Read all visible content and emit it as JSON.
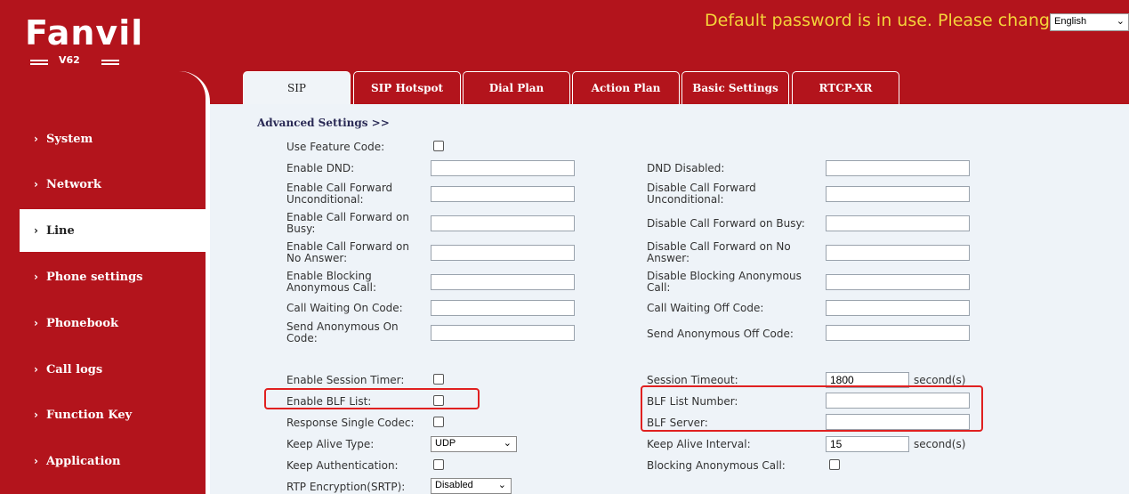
{
  "header": {
    "brand": "Fanvil",
    "model": "V62",
    "warning": "Default password is in use. Please change",
    "language": "English"
  },
  "sidebar": {
    "items": [
      {
        "label": "System"
      },
      {
        "label": "Network"
      },
      {
        "label": "Line"
      },
      {
        "label": "Phone settings"
      },
      {
        "label": "Phonebook"
      },
      {
        "label": "Call logs"
      },
      {
        "label": "Function Key"
      },
      {
        "label": "Application"
      }
    ],
    "active": "Line"
  },
  "tabs": [
    {
      "label": "SIP"
    },
    {
      "label": "SIP Hotspot"
    },
    {
      "label": "Dial Plan"
    },
    {
      "label": "Action Plan"
    },
    {
      "label": "Basic Settings"
    },
    {
      "label": "RTCP-XR"
    }
  ],
  "section_title": "Advanced Settings >>",
  "form": {
    "use_feature_code": "Use Feature Code:",
    "enable_dnd": "Enable DND:",
    "dnd_disabled": "DND Disabled:",
    "enable_cf_uncond_1": "Enable Call Forward",
    "enable_cf_uncond_2": "Unconditional:",
    "disable_cf_uncond_1": "Disable Call Forward",
    "disable_cf_uncond_2": "Unconditional:",
    "enable_cf_busy_1": "Enable Call Forward on",
    "enable_cf_busy_2": "Busy:",
    "disable_cf_busy": "Disable Call Forward on Busy:",
    "enable_cf_noans_1": "Enable Call Forward on",
    "enable_cf_noans_2": "No Answer:",
    "disable_cf_noans_1": "Disable Call Forward on No",
    "disable_cf_noans_2": "Answer:",
    "enable_block_anon_1": "Enable Blocking",
    "enable_block_anon_2": "Anonymous Call:",
    "disable_block_anon_1": "Disable Blocking Anonymous",
    "disable_block_anon_2": "Call:",
    "call_waiting_on": "Call Waiting On Code:",
    "call_waiting_off": "Call Waiting Off Code:",
    "send_anon_on_1": "Send Anonymous On",
    "send_anon_on_2": "Code:",
    "send_anon_off": "Send Anonymous Off Code:",
    "enable_session_timer": "Enable Session Timer:",
    "session_timeout": "Session Timeout:",
    "session_timeout_value": "1800",
    "session_timeout_unit": "second(s)",
    "enable_blf_list": "Enable BLF List:",
    "blf_list_number": "BLF List Number:",
    "response_single_codec": "Response Single Codec:",
    "blf_server": "BLF Server:",
    "keep_alive_type": "Keep Alive Type:",
    "keep_alive_type_value": "UDP",
    "keep_alive_interval": "Keep Alive Interval:",
    "keep_alive_interval_value": "15",
    "keep_alive_interval_unit": "second(s)",
    "keep_authentication": "Keep Authentication:",
    "blocking_anon_call": "Blocking Anonymous Call:",
    "rtp_encryption": "RTP Encryption(SRTP):",
    "rtp_encryption_value": "Disabled"
  },
  "colors": {
    "brand_red": "#b3141c",
    "warning_yellow": "#f4d43a",
    "content_bg": "#eef3f8",
    "highlight_red": "#e02020"
  }
}
